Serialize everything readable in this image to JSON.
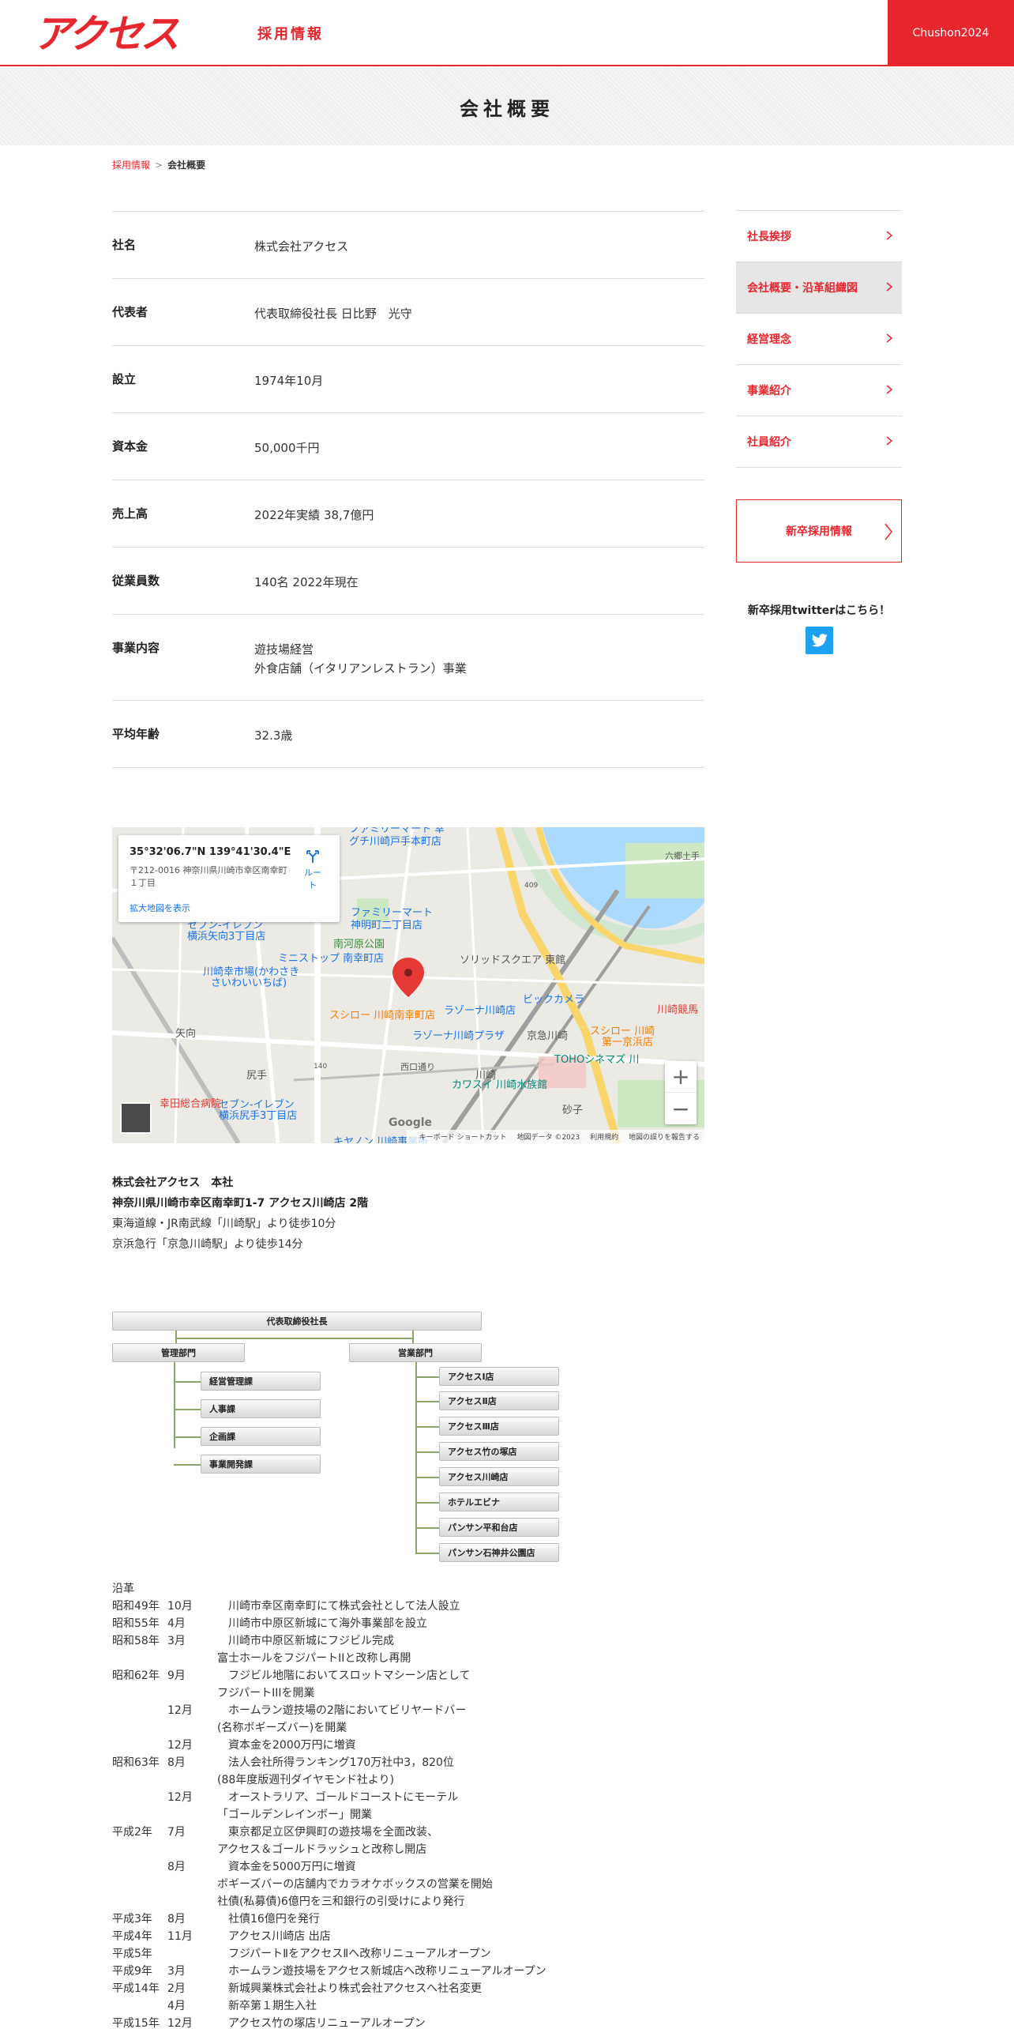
{
  "header": {
    "logo_text": "アクセス",
    "recruit_label": "採用情報",
    "button_label": "Chushon2024"
  },
  "page_title": "会社概要",
  "breadcrumb": {
    "link": "採用情報",
    "separator": ">",
    "current": "会社概要"
  },
  "company_info": [
    {
      "label": "社名",
      "value": "株式会社アクセス"
    },
    {
      "label": "代表者",
      "value": "代表取締役社長 日比野　光守"
    },
    {
      "label": "設立",
      "value": "1974年10月"
    },
    {
      "label": "資本金",
      "value": "50,000千円"
    },
    {
      "label": "売上高",
      "value": "2022年実績 38,7億円"
    },
    {
      "label": "従業員数",
      "value": "140名 2022年現在"
    },
    {
      "label": "事業内容",
      "value": "遊技場経営",
      "value2": "外食店舗（イタリアンレストラン）事業"
    },
    {
      "label": "平均年齢",
      "value": "32.3歳"
    }
  ],
  "sidenav": {
    "items": [
      {
        "label": "社長挨拶"
      },
      {
        "label": "会社概要・沿革組織図"
      },
      {
        "label": "経営理念"
      },
      {
        "label": "事業紹介"
      },
      {
        "label": "社員紹介"
      }
    ],
    "newgrad_button": "新卒採用情報",
    "twitter_text": "新卒採用twitterはこちら！"
  },
  "map": {
    "coords": "35°32'06.7\"N 139°41'30.4\"E",
    "address": "〒212-0016 神奈川県川崎市幸区南幸町１丁目",
    "enlarge": "拡大地図を表示",
    "route": "ルート",
    "zoom_in": "+",
    "zoom_out": "−",
    "google": "Google",
    "footer": {
      "shortcuts": "キーボード ショートカット",
      "data": "地図データ ©2023",
      "terms": "利用規約",
      "report": "地図の誤りを報告する"
    },
    "labels": {
      "familymart1": "ファミリーマート 幸",
      "familymart1b": "グチ川崎戸手本町店",
      "familymart2": "ファミリーマート",
      "familymart2b": "神明町二丁目店",
      "seven1": "セブン-イレブン",
      "seven1b": "横浜矢向3丁目店",
      "ministop": "ミニストップ 南幸町店",
      "park": "南河原公園",
      "market": "川崎幸市場(かわさき",
      "marketb": "さいわいいちば)",
      "solid": "ソリッドスクエア 東館",
      "biccamera": "ビックカメラ",
      "biccamerab": "ラゾーナ川崎店",
      "sushiro1": "スシロー 川崎南幸町店",
      "lazona": "ラゾーナ川崎プラザ",
      "keikyu": "京急川崎",
      "sushiro2": "スシロー 川崎",
      "sushiro2b": "第一京浜店",
      "toho": "TOHOシネマズ 川",
      "kawasaki_kenba": "川崎競馬",
      "yako": "矢向",
      "shiriteno": "尻手",
      "nishiguchi": "西口通り",
      "canon": "キヤノン 川崎事業所",
      "aquarium": "カワスイ 川崎水族館",
      "hospital": "幸田総合病院",
      "seven2": "セブン-イレブン",
      "seven2b": "横浜尻手3丁目店",
      "sunako": "砂子",
      "kawasaki": "川崎",
      "rokugo": "六郷土手",
      "route409": "409",
      "route140": "140"
    }
  },
  "address_block": {
    "line1": "株式会社アクセス　本社",
    "line2": "神奈川県川崎市幸区南幸町1-7 アクセス川崎店 2階",
    "line3": "東海道線・JR南武線「川崎駅」より徒歩10分",
    "line4": "京浜急行「京急川崎駅」より徒歩14分"
  },
  "org_chart": {
    "ceo": "代表取締役社長",
    "management": "管理部門",
    "sales": "営業部門",
    "management_units": [
      "経営管理課",
      "人事課",
      "企画課",
      "事業開発課"
    ],
    "sales_units": [
      "アクセスⅠ店",
      "アクセスⅡ店",
      "アクセスⅢ店",
      "アクセス竹の塚店",
      "アクセス川崎店",
      "ホテルエビナ",
      "パンサン平和台店",
      "パンサン石神井公園店"
    ]
  },
  "history": {
    "title": "沿革",
    "rows": [
      {
        "era": "昭和49年",
        "month": "10月",
        "event": "　川崎市幸区南幸町にて株式会社として法人設立"
      },
      {
        "era": "昭和55年",
        "month": "4月",
        "event": "　川崎市中原区新城にて海外事業部を設立"
      },
      {
        "era": "昭和58年",
        "month": "3月",
        "event": "　川崎市中原区新城にフジビル完成"
      },
      {
        "era": "",
        "month": "",
        "event": "富士ホールをフジパートIIと改称し再開"
      },
      {
        "era": "昭和62年",
        "month": "9月",
        "event": "　フジビル地階においてスロットマシーン店として"
      },
      {
        "era": "",
        "month": "",
        "event": "フジパートIIIを開業"
      },
      {
        "era": "",
        "month": "12月",
        "event": "　ホームラン遊技場の2階においてビリヤードバー"
      },
      {
        "era": "",
        "month": "",
        "event": "(名称ボギーズバー)を開業"
      },
      {
        "era": "",
        "month": "12月",
        "event": "　資本金を2000万円に増資"
      },
      {
        "era": "昭和63年",
        "month": "8月",
        "event": "　法人会社所得ランキング170万社中3，820位"
      },
      {
        "era": "",
        "month": "",
        "event": "(88年度版週刊ダイヤモンド社より)"
      },
      {
        "era": "",
        "month": "12月",
        "event": "　オーストラリア、ゴールドコーストにモーテル"
      },
      {
        "era": "",
        "month": "",
        "event": "「ゴールデンレインボー」開業"
      },
      {
        "era": "平成2年",
        "month": "7月",
        "event": "　東京都足立区伊興町の遊技場を全面改装、"
      },
      {
        "era": "",
        "month": "",
        "event": "アクセス＆ゴールドラッシュと改称し開店"
      },
      {
        "era": "",
        "month": "8月",
        "event": "　資本金を5000万円に増資"
      },
      {
        "era": "",
        "month": "",
        "event": "ボギーズバーの店舗内でカラオケボックスの営業を開始"
      },
      {
        "era": "",
        "month": "",
        "event": "社債(私募債)6億円を三和銀行の引受けにより発行"
      },
      {
        "era": "平成3年",
        "month": "8月",
        "event": "　社債16億円を発行"
      },
      {
        "era": "平成4年",
        "month": "11月",
        "event": "　アクセス川崎店 出店"
      },
      {
        "era": "平成5年",
        "month": "",
        "event": "　フジパートⅡをアクセスⅡへ改称リニューアルオープン"
      },
      {
        "era": "平成9年",
        "month": "3月",
        "event": "　ホームラン遊技場をアクセス新城店へ改称リニューアルオープン"
      },
      {
        "era": "平成14年",
        "month": "2月",
        "event": "　新城興業株式会社より株式会社アクセスへ社名変更"
      },
      {
        "era": "",
        "month": "4月",
        "event": "　新卒第１期生入社"
      },
      {
        "era": "平成15年",
        "month": "12月",
        "event": "　アクセス竹の塚店リニューアルオープン"
      }
    ]
  },
  "colors": {
    "accent": "#e8262d",
    "twitter": "#1da1f2",
    "map_water": "#aadaff",
    "map_road": "#f9d56b"
  }
}
